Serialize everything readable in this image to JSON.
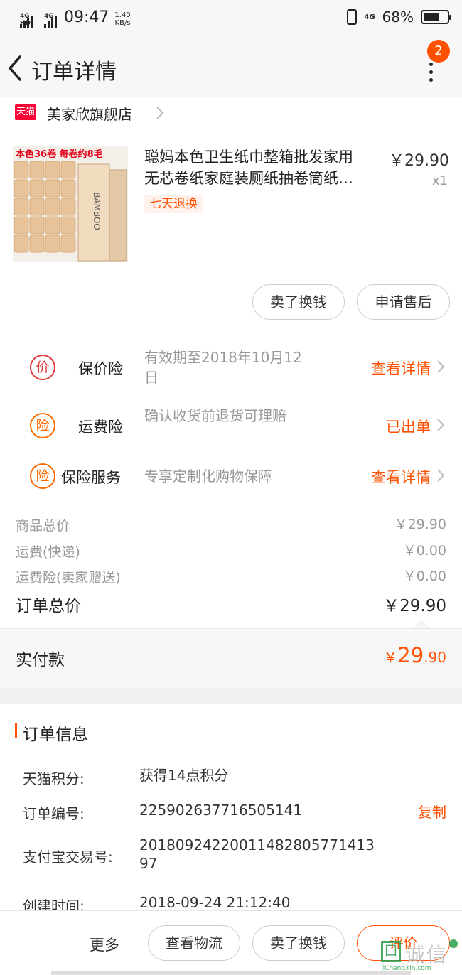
{
  "status_bar": {
    "sim1": "4G HD",
    "sim2": "4G",
    "time": "09:47",
    "speed_value": "1.40",
    "speed_unit": "KB/s",
    "network_right": "4G",
    "battery": "68%",
    "battery_level": 0.68
  },
  "nav": {
    "title": "订单详情",
    "notification_count": "2"
  },
  "shop": {
    "badge": "天猫",
    "name": "美家欣旗舰店"
  },
  "product": {
    "title_line1": "聪妈本色卫生纸巾整箱批发家用",
    "title_line2": "无芯卷纸家庭装厕纸抽卷筒纸…",
    "price": "￥29.90",
    "quantity": "x1",
    "tag": "七天退换",
    "image_banner": "本色36卷 每卷约8毛",
    "image_brand": "BAMBOO"
  },
  "product_actions": {
    "sell_button": "卖了换钱",
    "after_sale_button": "申请售后"
  },
  "insurance": [
    {
      "icon_char": "价",
      "name": "保价险",
      "desc": "有效期至2018年10月12日",
      "action": "查看详情"
    },
    {
      "icon_char": "险",
      "name": "运费险",
      "desc": "确认收货前退货可理赔",
      "action": "已出单"
    },
    {
      "icon_char": "险",
      "name": "保险服务",
      "desc": "专享定制化购物保障",
      "action": "查看详情"
    }
  ],
  "fees": [
    {
      "label": "商品总价",
      "value": "￥29.90"
    },
    {
      "label": "运费(快递)",
      "value": "￥0.00"
    },
    {
      "label": "运费险(卖家赠送)",
      "value": "￥0.00"
    }
  ],
  "total": {
    "label": "订单总价",
    "value": "￥29.90"
  },
  "paid": {
    "label": "实付款",
    "currency": "￥",
    "integer": "29",
    "decimal": ".90"
  },
  "order_info": {
    "title": "订单信息",
    "rows": [
      {
        "label": "天猫积分:",
        "value": "获得14点积分"
      },
      {
        "label": "订单编号:",
        "value": "225902637716505141",
        "action": "复制"
      },
      {
        "label": "支付宝交易号:",
        "value": "20180924220011482805771413 97"
      },
      {
        "label": "创建时间:",
        "value": "2018-09-24 21:12:40"
      }
    ]
  },
  "bottom_bar": {
    "more": "更多",
    "logistics_button": "查看物流",
    "sell_button": "卖了换钱",
    "evaluate_button": "评价"
  },
  "watermark": {
    "text": "诚信",
    "url": "JiChengXin.com"
  },
  "colors": {
    "accent": "#ff5000",
    "tmall_red": "#ff0036"
  }
}
